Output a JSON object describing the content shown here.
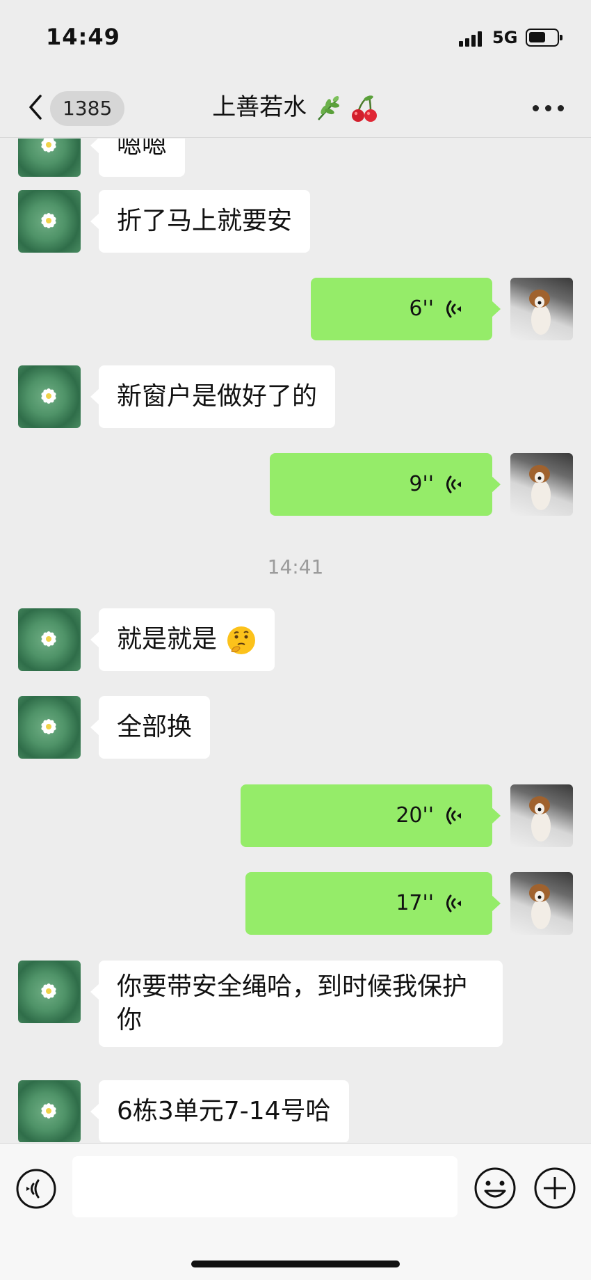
{
  "status_bar": {
    "time": "14:49",
    "network": "5G",
    "battery_level": 0.6
  },
  "nav": {
    "unread_count": "1385",
    "title": "上善若水"
  },
  "messages": [
    {
      "side": "in",
      "kind": "text",
      "text": "嗯嗯"
    },
    {
      "side": "in",
      "kind": "text",
      "text": "折了马上就要安"
    },
    {
      "side": "out",
      "kind": "voice",
      "duration": "6''"
    },
    {
      "side": "in",
      "kind": "text",
      "text": "新窗户是做好了的"
    },
    {
      "side": "out",
      "kind": "voice",
      "duration": "9''"
    },
    {
      "kind": "time",
      "text": "14:41"
    },
    {
      "side": "in",
      "kind": "text",
      "text": "就是就是"
    },
    {
      "side": "in",
      "kind": "text",
      "text": "全部换"
    },
    {
      "side": "out",
      "kind": "voice",
      "duration": "20''"
    },
    {
      "side": "out",
      "kind": "voice",
      "duration": "17''"
    },
    {
      "side": "in",
      "kind": "text",
      "text": "你要带安全绳哈，到时候我保护你"
    },
    {
      "side": "in",
      "kind": "text",
      "text": "6栋3单元7-14号哈"
    }
  ],
  "input": {
    "value": "",
    "placeholder": ""
  },
  "icons": {
    "back": "chevron-left-icon",
    "more": "more-dots-icon",
    "voice_toggle": "voice-input-icon",
    "emoji": "emoji-icon",
    "plus": "plus-icon",
    "title_decor": [
      "herb-emoji",
      "cherry-emoji"
    ],
    "reaction": "thinking-face-emoji"
  },
  "colors": {
    "background": "#ededed",
    "outgoing_bubble": "#95ec69",
    "incoming_bubble": "#ffffff",
    "timestamp": "#9b9b9b"
  }
}
